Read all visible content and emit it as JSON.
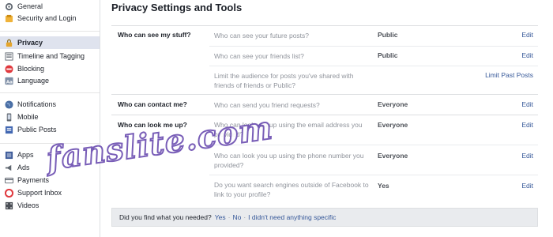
{
  "sidebar": {
    "items": [
      {
        "label": "General",
        "icon": "gear-icon"
      },
      {
        "label": "Security and Login",
        "icon": "shield-icon"
      },
      {
        "label": "Privacy",
        "icon": "lock-icon",
        "active": true
      },
      {
        "label": "Timeline and Tagging",
        "icon": "timeline-icon"
      },
      {
        "label": "Blocking",
        "icon": "block-icon"
      },
      {
        "label": "Language",
        "icon": "language-icon"
      },
      {
        "label": "Notifications",
        "icon": "globe-icon"
      },
      {
        "label": "Mobile",
        "icon": "mobile-icon"
      },
      {
        "label": "Public Posts",
        "icon": "public-posts-icon"
      },
      {
        "label": "Apps",
        "icon": "apps-icon"
      },
      {
        "label": "Ads",
        "icon": "ads-icon"
      },
      {
        "label": "Payments",
        "icon": "payments-icon"
      },
      {
        "label": "Support Inbox",
        "icon": "lifebuoy-icon"
      },
      {
        "label": "Videos",
        "icon": "video-icon"
      }
    ]
  },
  "main": {
    "title": "Privacy Settings and Tools",
    "sections": [
      {
        "label": "Who can see my stuff?",
        "rows": [
          {
            "question": "Who can see your future posts?",
            "value": "Public",
            "action": "Edit"
          },
          {
            "question": "Who can see your friends list?",
            "value": "Public",
            "action": "Edit"
          },
          {
            "question": "Limit the audience for posts you've shared with friends of friends or Public?",
            "value": "",
            "action": "Limit Past Posts"
          }
        ]
      },
      {
        "label": "Who can contact me?",
        "rows": [
          {
            "question": "Who can send you friend requests?",
            "value": "Everyone",
            "action": "Edit"
          }
        ]
      },
      {
        "label": "Who can look me up?",
        "rows": [
          {
            "question": "Who can look you up using the email address you provided?",
            "value": "Everyone",
            "action": "Edit"
          },
          {
            "question": "Who can look you up using the phone number you provided?",
            "value": "Everyone",
            "action": "Edit"
          },
          {
            "question": "Do you want search engines outside of Facebook to link to your profile?",
            "value": "Yes",
            "action": "Edit"
          }
        ]
      }
    ]
  },
  "footer": {
    "question": "Did you find what you needed?",
    "yes": "Yes",
    "no": "No",
    "none": "I didn't need anything specific",
    "separator": "·"
  },
  "watermark": "fanslite.com",
  "colors": {
    "link": "#365899",
    "active_bg": "#dfe3ee",
    "footer_bg": "#e9ebee"
  }
}
